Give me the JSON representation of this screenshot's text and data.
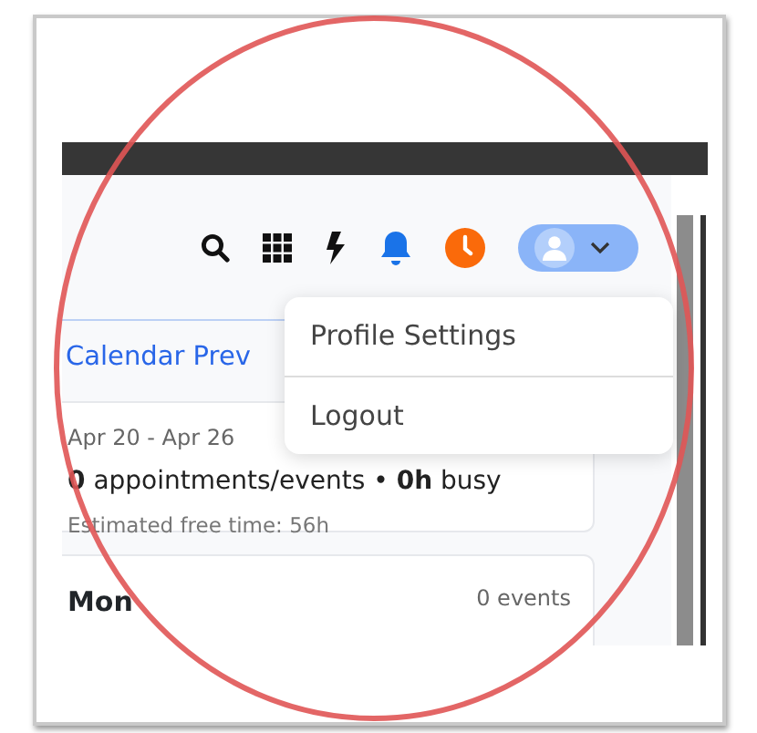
{
  "user_menu": {
    "open": true,
    "items": [
      {
        "label": "Profile Settings"
      },
      {
        "label": "Logout"
      }
    ]
  },
  "heading": "Calendar Prev",
  "week_summary": {
    "range": "Apr 20 - Apr 26",
    "summary": "**0** appointments/events • **0h** busy",
    "free_time": "Estimated free time: 56h"
  },
  "days": [
    {
      "day": "Mon",
      "count": "0 events"
    }
  ]
}
